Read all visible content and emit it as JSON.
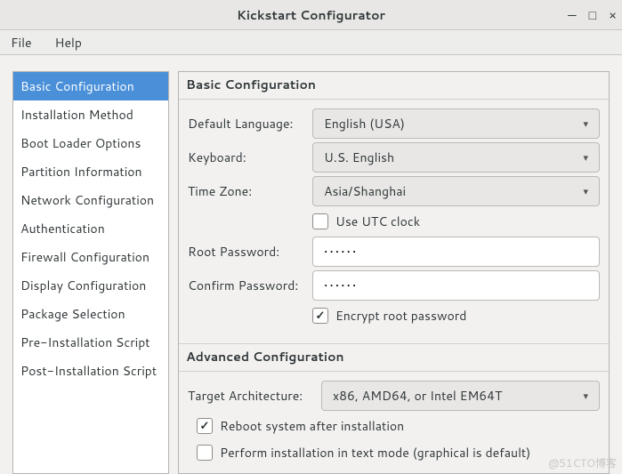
{
  "window": {
    "title": "Kickstart Configurator",
    "controls": {
      "minimize": "—",
      "maximize": "□",
      "close": "×"
    }
  },
  "menubar": {
    "file": "File",
    "help": "Help"
  },
  "sidebar": {
    "items": [
      "Basic Configuration",
      "Installation Method",
      "Boot Loader Options",
      "Partition Information",
      "Network Configuration",
      "Authentication",
      "Firewall Configuration",
      "Display Configuration",
      "Package Selection",
      "Pre-Installation Script",
      "Post-Installation Script"
    ],
    "selected_index": 0
  },
  "basic": {
    "heading": "Basic Configuration",
    "language_label": "Default Language:",
    "language_value": "English (USA)",
    "keyboard_label": "Keyboard:",
    "keyboard_value": "U.S. English",
    "timezone_label": "Time Zone:",
    "timezone_value": "Asia/Shanghai",
    "utc_label": "Use UTC clock",
    "utc_checked": false,
    "rootpw_label": "Root Password:",
    "rootpw_value": "••••••",
    "confirmpw_label": "Confirm Password:",
    "confirmpw_value": "••••••",
    "encrypt_label": "Encrypt root password",
    "encrypt_checked": true
  },
  "advanced": {
    "heading": "Advanced Configuration",
    "arch_label": "Target Architecture:",
    "arch_value": "x86, AMD64, or Intel EM64T",
    "reboot_label": "Reboot system after installation",
    "reboot_checked": true,
    "textmode_label": "Perform installation in text mode (graphical is default)",
    "textmode_checked": false
  },
  "watermark": "@51CTO博客"
}
